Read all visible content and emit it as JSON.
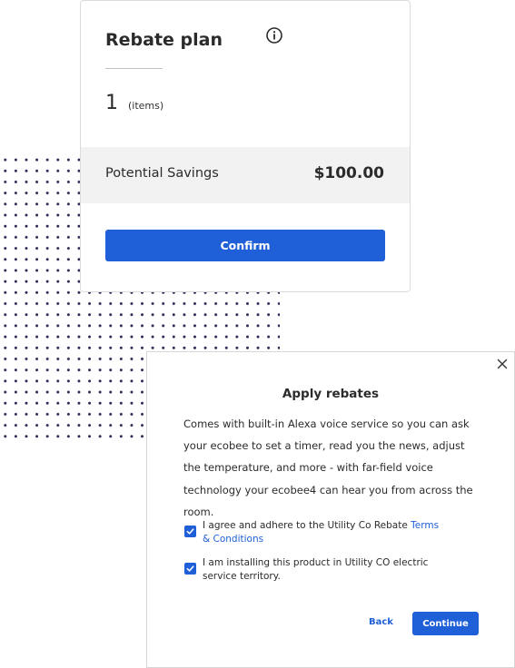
{
  "card": {
    "title": "Rebate plan",
    "info_icon": "info-circle-icon",
    "item_count": "1",
    "item_unit": "(items)",
    "savings_label": "Potential Savings",
    "savings_value": "$100.00",
    "confirm_label": "Confirm"
  },
  "modal": {
    "close_icon": "close-icon",
    "title": "Apply rebates",
    "body": "Comes with built-in Alexa voice service so you can ask your ecobee to set a timer, read you the news, adjust the temperature, and more - with far-field voice technology your ecobee4 can hear you from across the room.",
    "agree_text": "I agree and adhere to the Utility Co Rebate ",
    "agree_link": "Terms & Conditions",
    "agree_checked": true,
    "install_text": "I am installing this product in Utility CO electric service territory.",
    "install_checked": true,
    "back_label": "Back",
    "continue_label": "Continue"
  },
  "colors": {
    "accent": "#1f5fd8",
    "dots": "#2f2a55",
    "savings_bg": "#f2f2f2"
  }
}
